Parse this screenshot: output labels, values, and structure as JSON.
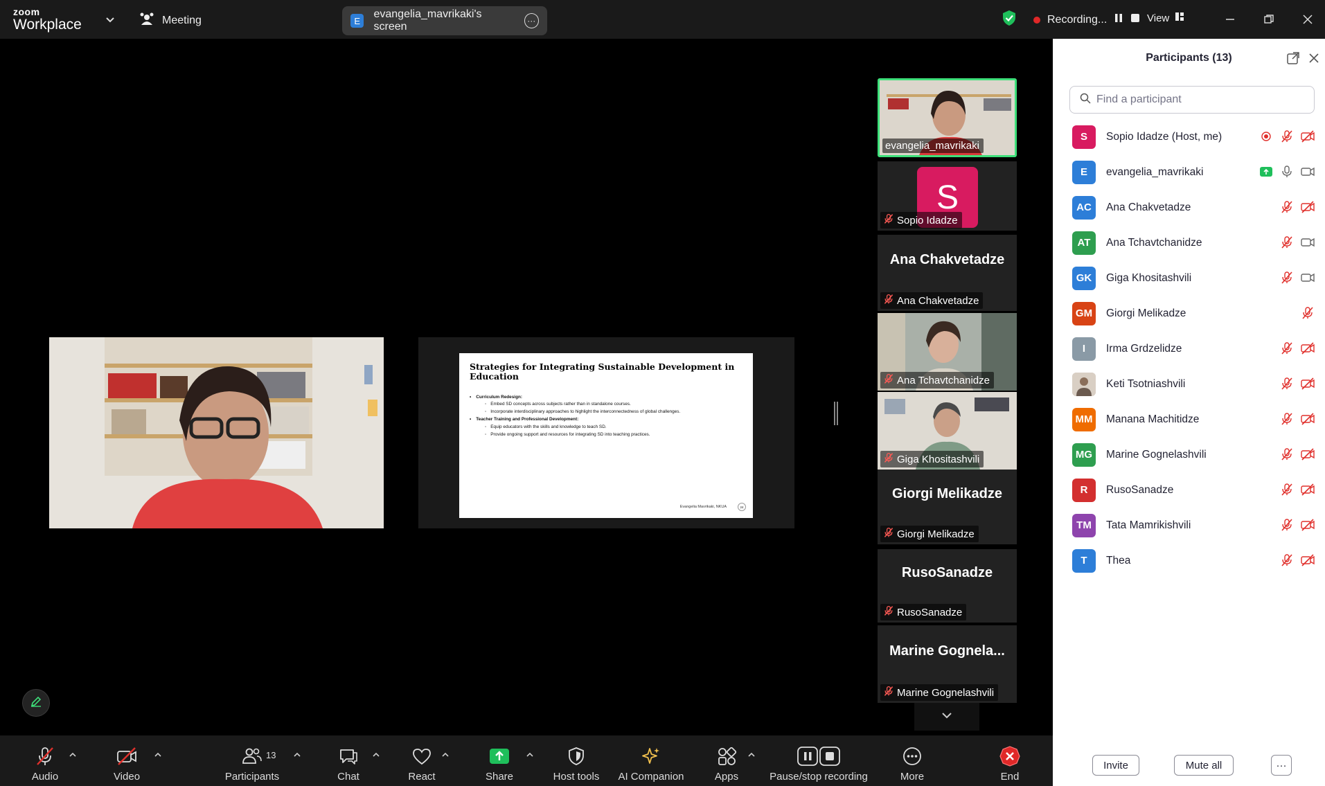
{
  "titlebar": {
    "brand_top": "zoom",
    "brand_bottom": "Workplace",
    "meeting_label": "Meeting",
    "screen_badge": "E",
    "screen_label": "evangelia_mavrikaki's screen",
    "recording_label": "Recording...",
    "view_label": "View"
  },
  "stage": {
    "camera_name": "evangelia_mavrikaki",
    "slide": {
      "title": "Strategies for Integrating Sustainable Development in Education",
      "items": [
        {
          "kind": "top",
          "text": "Curriculum Redesign:"
        },
        {
          "kind": "sub",
          "text": "Embed SD concepts across subjects rather than in standalone courses."
        },
        {
          "kind": "sub",
          "text": "Incorporate interdisciplinary approaches to highlight the interconnectedness of global challenges."
        },
        {
          "kind": "top",
          "text": "Teacher Training and Professional Development:"
        },
        {
          "kind": "sub",
          "text": "Equip educators with the skills and knowledge to teach SD."
        },
        {
          "kind": "sub",
          "text": "Provide ongoing support and resources for integrating SD into teaching practices."
        }
      ],
      "footer": "Evangelia Mavrikaki, NKUA",
      "page": "24"
    }
  },
  "gallery": [
    {
      "name": "evangelia_mavrikaki",
      "type": "video",
      "active": true
    },
    {
      "name": "Sopio Idadze",
      "type": "avatar",
      "initial": "S",
      "color": "#d81b60"
    },
    {
      "name": "Ana Chakvetadze",
      "type": "name",
      "big": "Ana Chakvetadze"
    },
    {
      "name": "Ana Tchavtchanidze",
      "type": "video"
    },
    {
      "name": "Giga Khositashvili",
      "type": "video"
    },
    {
      "name": "Giorgi Melikadze",
      "type": "name",
      "big": "Giorgi Melikadze"
    },
    {
      "name": "RusoSanadze",
      "type": "name",
      "big": "RusoSanadze"
    },
    {
      "name": "Marine Gognelashvili",
      "type": "name",
      "big": "Marine  Gognela..."
    }
  ],
  "participants": {
    "title": "Participants (13)",
    "search_placeholder": "Find a participant",
    "list": [
      {
        "initials": "S",
        "name": "Sopio Idadze (Host, me)",
        "color": "#d81b60",
        "status": "host"
      },
      {
        "initials": "E",
        "name": "evangelia_mavrikaki",
        "color": "#2d7ed8",
        "status": "sharing"
      },
      {
        "initials": "AC",
        "name": "Ana Chakvetadze",
        "color": "#2d7ed8",
        "status": "muted-novideo"
      },
      {
        "initials": "AT",
        "name": "Ana Tchavtchanidze",
        "color": "#2e9e4f",
        "status": "muted-video"
      },
      {
        "initials": "GK",
        "name": "Giga Khositashvili",
        "color": "#2d7ed8",
        "status": "muted-video"
      },
      {
        "initials": "GM",
        "name": "Giorgi Melikadze",
        "color": "#d84315",
        "status": "muted-only"
      },
      {
        "initials": "I",
        "name": "Irma Grdzelidze",
        "color": "#8a9aa6",
        "status": "muted-novideo"
      },
      {
        "initials": "",
        "name": "Keti Tsotniashvili",
        "color": "#c8b8a8",
        "status": "muted-novideo"
      },
      {
        "initials": "MM",
        "name": "Manana Machitidze",
        "color": "#ef6c00",
        "status": "muted-novideo"
      },
      {
        "initials": "MG",
        "name": "Marine Gognelashvili",
        "color": "#2e9e4f",
        "status": "muted-novideo"
      },
      {
        "initials": "R",
        "name": "RusoSanadze",
        "color": "#d32f2f",
        "status": "muted-novideo"
      },
      {
        "initials": "TM",
        "name": "Tata Mamrikishvili",
        "color": "#8e44ad",
        "status": "muted-novideo"
      },
      {
        "initials": "T",
        "name": "Thea",
        "color": "#2d7ed8",
        "status": "muted-novideo"
      }
    ],
    "invite_label": "Invite",
    "mute_all_label": "Mute all",
    "more_label": "···"
  },
  "toolbar": {
    "audio": "Audio",
    "video": "Video",
    "participants": "Participants",
    "participants_count": "13",
    "chat": "Chat",
    "react": "React",
    "share": "Share",
    "host_tools": "Host tools",
    "ai_companion": "AI Companion",
    "apps": "Apps",
    "pause_recording": "Pause/stop recording",
    "more": "More",
    "end": "End"
  },
  "colors": {
    "accent_green": "#3ee07a",
    "share_green": "#1fbf5b",
    "end_red": "#e02828",
    "recording_red": "#e02828",
    "muted_red": "#e0302c"
  }
}
